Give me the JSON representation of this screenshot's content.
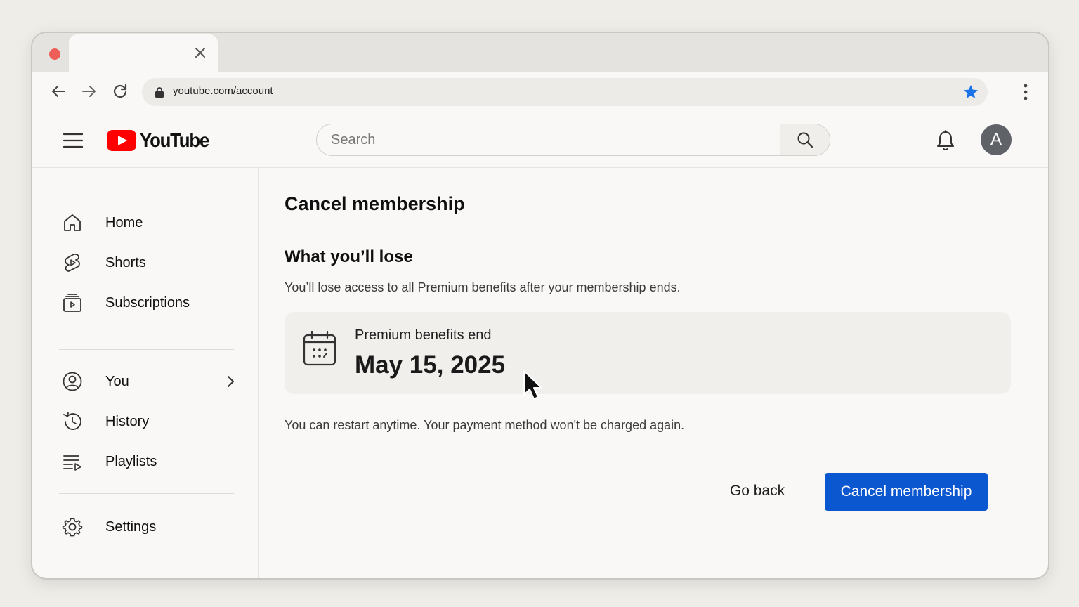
{
  "browser": {
    "url": "youtube.com/account",
    "bookmark_color": "#1a73e8"
  },
  "header": {
    "logo_text": "YouTube",
    "logo_color": "#ff0000",
    "search_placeholder": "Search",
    "avatar_initial": "A"
  },
  "sidebar": {
    "items": [
      {
        "label": "Home",
        "icon": "home-icon"
      },
      {
        "label": "Shorts",
        "icon": "shorts-icon"
      },
      {
        "label": "Subscriptions",
        "icon": "subscriptions-icon"
      },
      {
        "label": "You",
        "icon": "account-circle-icon"
      },
      {
        "label": "History",
        "icon": "history-icon"
      },
      {
        "label": "Playlists",
        "icon": "playlists-icon"
      },
      {
        "label": "Settings",
        "icon": "gear-icon"
      }
    ]
  },
  "main": {
    "title": "Cancel membership",
    "section_title": "What you’ll lose",
    "description": "You’ll lose access to all Premium benefits after your membership ends.",
    "card": {
      "label": "Premium benefits end",
      "date": "May 15, 2025"
    },
    "note": "You can restart anytime. Your payment method won't be charged again.",
    "go_back_label": "Go back",
    "cancel_label": "Cancel membership",
    "primary_color": "#0b57d0"
  }
}
